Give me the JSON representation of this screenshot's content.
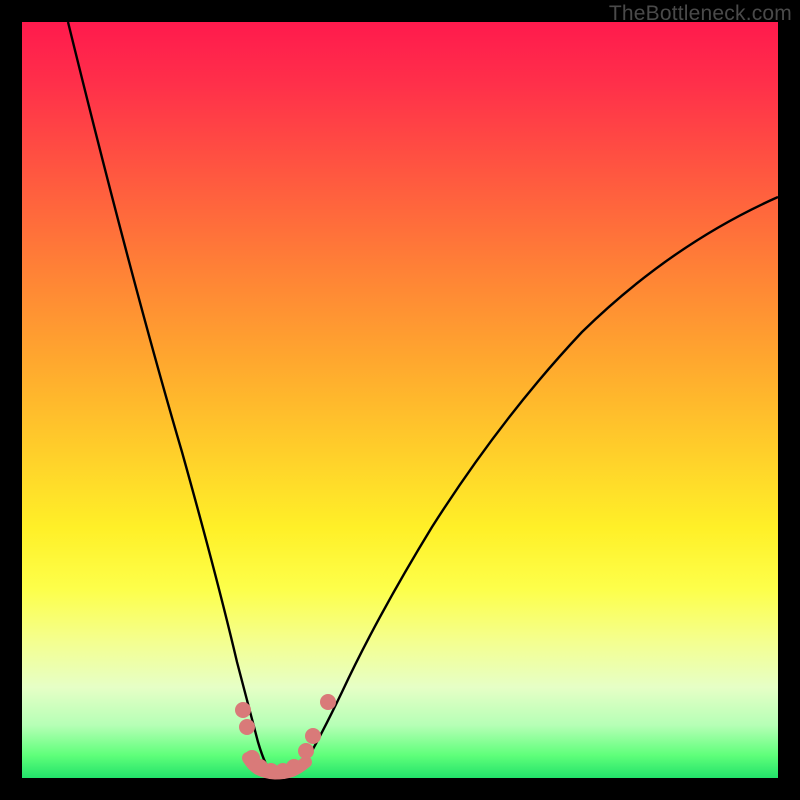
{
  "attribution": "TheBottleneck.com",
  "colors": {
    "frame": "#000000",
    "curve": "#000000",
    "marker_fill": "#d97a79",
    "gradient_top": "#ff1a4d",
    "gradient_bottom": "#22e26a"
  },
  "chart_data": {
    "type": "line",
    "title": "",
    "xlabel": "",
    "ylabel": "",
    "xlim": [
      0,
      100
    ],
    "ylim": [
      0,
      100
    ],
    "grid": false,
    "legend": false,
    "notes": "Bottleneck-style V-curve over rainbow gradient. Axes unlabeled; values are relative pixel-percent estimates read from the figure. y=0 is bottom (green), y=100 is top (red). Minimum (optimal) near x≈33.",
    "series": [
      {
        "name": "left-branch",
        "x": [
          6,
          10,
          14,
          18,
          22,
          25,
          27,
          29,
          30.5,
          32
        ],
        "y": [
          100,
          78,
          57,
          39,
          24,
          14,
          8,
          4,
          2,
          0.7
        ]
      },
      {
        "name": "right-branch",
        "x": [
          37,
          39,
          42,
          46,
          52,
          60,
          70,
          82,
          94,
          100
        ],
        "y": [
          0.7,
          3,
          7,
          14,
          24,
          37,
          51,
          63,
          72,
          76
        ]
      },
      {
        "name": "valley-floor",
        "x": [
          30,
          31,
          32,
          33,
          34,
          35,
          36,
          37
        ],
        "y": [
          2.4,
          1.4,
          0.9,
          0.6,
          0.6,
          0.8,
          1.2,
          2.1
        ]
      }
    ],
    "markers": [
      {
        "x": 29.3,
        "y": 9.0
      },
      {
        "x": 29.8,
        "y": 6.7
      },
      {
        "x": 30.4,
        "y": 2.7
      },
      {
        "x": 31.5,
        "y": 1.4
      },
      {
        "x": 33.0,
        "y": 0.9
      },
      {
        "x": 34.5,
        "y": 0.9
      },
      {
        "x": 36.0,
        "y": 1.4
      },
      {
        "x": 37.5,
        "y": 3.6
      },
      {
        "x": 38.5,
        "y": 5.6
      },
      {
        "x": 40.5,
        "y": 10.0
      }
    ]
  }
}
